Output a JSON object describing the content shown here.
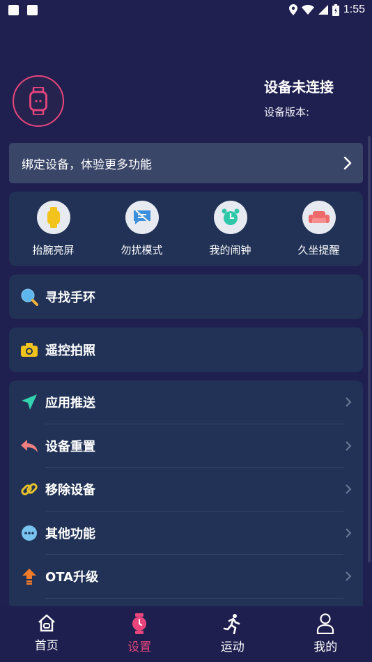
{
  "status_bar": {
    "time": "1:55"
  },
  "header": {
    "device_status": "设备未连接",
    "device_version": "设备版本:"
  },
  "bind_banner": {
    "label": "绑定设备，体验更多功能"
  },
  "quick_functions": [
    {
      "label": "抬腕亮屏",
      "icon": "watch-raise-icon",
      "color": "#f2c31a"
    },
    {
      "label": "勿扰模式",
      "icon": "no-disturb-icon",
      "color": "#3b8fdc"
    },
    {
      "label": "我的闹钟",
      "icon": "alarm-clock-icon",
      "color": "#2ec7a9"
    },
    {
      "label": "久坐提醒",
      "icon": "sofa-icon",
      "color": "#ef6a6a"
    }
  ],
  "find_band": {
    "label": "寻找手环",
    "icon": "search-icon"
  },
  "remote_photo": {
    "label": "遥控拍照",
    "icon": "camera-icon"
  },
  "settings_list": [
    {
      "label": "应用推送",
      "icon": "send-icon",
      "color": "#33d3b0"
    },
    {
      "label": "设备重置",
      "icon": "reply-icon",
      "color": "#ef7f7f"
    },
    {
      "label": "移除设备",
      "icon": "link-icon",
      "color": "#e8c22a"
    },
    {
      "label": "其他功能",
      "icon": "more-icon",
      "color": "#79c3f0"
    },
    {
      "label": "OTA升级",
      "icon": "upgrade-icon",
      "color": "#f27a28"
    }
  ],
  "bottom_nav": [
    {
      "label": "首页",
      "icon": "home-icon",
      "active": false
    },
    {
      "label": "设置",
      "icon": "watch-icon",
      "active": true
    },
    {
      "label": "运动",
      "icon": "running-icon",
      "active": false
    },
    {
      "label": "我的",
      "icon": "person-icon",
      "active": false
    }
  ],
  "colors": {
    "accent": "#e8457c",
    "background": "#1f2050",
    "card": "#213256"
  }
}
